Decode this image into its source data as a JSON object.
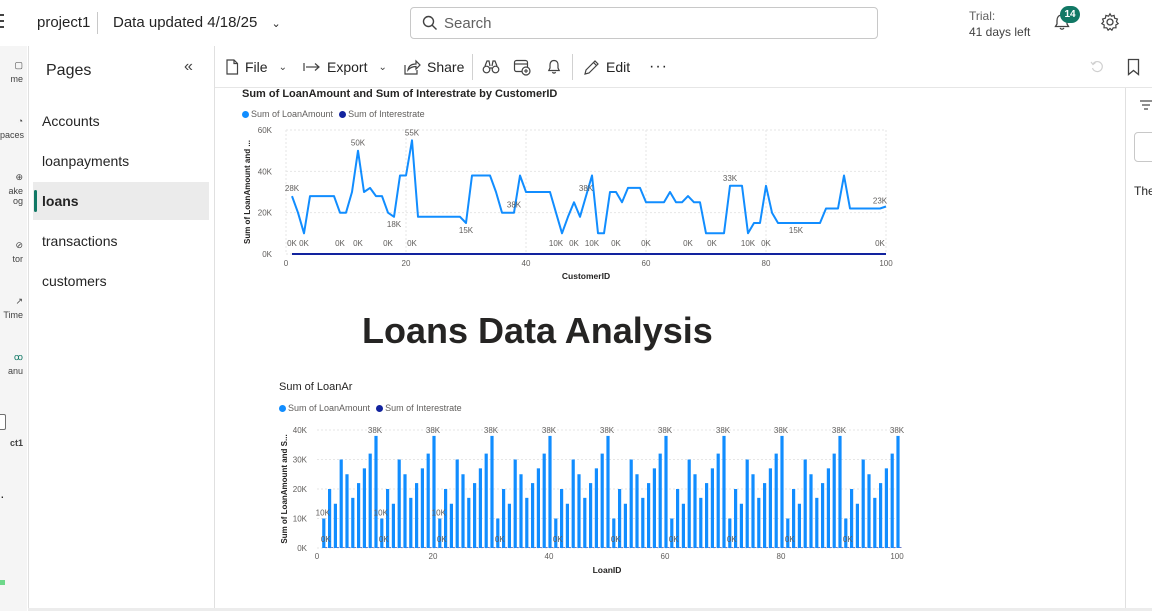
{
  "topbar": {
    "project_name": "project1",
    "data_updated": "Data updated 4/18/25",
    "search_placeholder": "Search",
    "trial_label": "Trial:",
    "trial_days": "41 days left",
    "notification_count": "14"
  },
  "left_rail": {
    "items": [
      "me",
      "paces",
      "ake",
      "og",
      "tor",
      "Time",
      "anu",
      "ct1"
    ]
  },
  "pages": {
    "title": "Pages",
    "items": [
      {
        "label": "Accounts"
      },
      {
        "label": "loanpayments"
      },
      {
        "label": "loans",
        "active": true
      },
      {
        "label": "transactions"
      },
      {
        "label": "customers"
      }
    ]
  },
  "toolbar": {
    "file": "File",
    "export": "Export",
    "share": "Share",
    "edit": "Edit"
  },
  "right_panel": {
    "text": "The"
  },
  "report": {
    "heading": "Loans Data Analysis"
  },
  "colors": {
    "series_loan": "#118DFF",
    "series_interest": "#12239E",
    "accent": "#117865"
  },
  "chart_data": [
    {
      "type": "line",
      "title": "Sum of LoanAmount and Sum of Interestrate by CustomerID",
      "xlabel": "CustomerID",
      "ylabel": "Sum of LoanAmount and ...",
      "xlim": [
        0,
        100
      ],
      "ylim": [
        0,
        60000
      ],
      "x_ticks": [
        "0",
        "20",
        "40",
        "60",
        "80",
        "100"
      ],
      "y_ticks": [
        "0K",
        "20K",
        "40K",
        "60K"
      ],
      "legend": [
        "Sum of LoanAmount",
        "Sum of Interestrate"
      ],
      "series": [
        {
          "name": "Sum of LoanAmount",
          "x": [
            1,
            2,
            3,
            4,
            5,
            6,
            7,
            8,
            9,
            10,
            11,
            12,
            13,
            14,
            15,
            16,
            17,
            18,
            19,
            20,
            21,
            22,
            23,
            24,
            25,
            26,
            27,
            28,
            29,
            30,
            31,
            32,
            33,
            34,
            35,
            36,
            37,
            38,
            39,
            40,
            41,
            42,
            43,
            44,
            45,
            46,
            47,
            48,
            49,
            50,
            51,
            52,
            53,
            54,
            55,
            56,
            57,
            58,
            59,
            60,
            61,
            62,
            63,
            64,
            65,
            66,
            67,
            68,
            69,
            70,
            71,
            72,
            73,
            74,
            75,
            76,
            77,
            78,
            79,
            80,
            81,
            82,
            83,
            84,
            85,
            86,
            87,
            88,
            89,
            90,
            91,
            92,
            93,
            94,
            95,
            96,
            97,
            98,
            99,
            100
          ],
          "values": [
            28000,
            20000,
            10000,
            28000,
            28000,
            28000,
            28000,
            28000,
            20000,
            20000,
            30000,
            50000,
            30000,
            32000,
            28000,
            28000,
            20000,
            18000,
            38000,
            38000,
            55000,
            18000,
            18000,
            18000,
            18000,
            18000,
            18000,
            18000,
            18000,
            15000,
            38000,
            38000,
            38000,
            38000,
            30000,
            20000,
            20000,
            20000,
            38000,
            30000,
            30000,
            30000,
            30000,
            30000,
            20000,
            10000,
            18000,
            25000,
            18000,
            28000,
            38000,
            10000,
            10000,
            30000,
            30000,
            25000,
            32000,
            32000,
            32000,
            25000,
            25000,
            25000,
            25000,
            30000,
            25000,
            25000,
            28000,
            25000,
            25000,
            10000,
            10000,
            10000,
            10000,
            33000,
            33000,
            33000,
            10000,
            15000,
            15000,
            33000,
            20000,
            15000,
            15000,
            15000,
            15000,
            15000,
            15000,
            15000,
            15000,
            22000,
            22000,
            22000,
            38000,
            22000,
            22000,
            22000,
            22000,
            22000,
            22000,
            23000
          ]
        },
        {
          "name": "Sum of Interestrate",
          "x": [
            1,
            100
          ],
          "values": [
            0,
            0
          ]
        }
      ],
      "data_labels": [
        {
          "x": 1,
          "text": "28K"
        },
        {
          "x": 12,
          "text": "50K"
        },
        {
          "x": 21,
          "text": "55K"
        },
        {
          "x": 18,
          "text": "18K"
        },
        {
          "x": 30,
          "text": "15K"
        },
        {
          "x": 38,
          "text": "38K"
        },
        {
          "x": 50,
          "text": "38K"
        },
        {
          "x": 74,
          "text": "33K"
        },
        {
          "x": 85,
          "text": "15K"
        },
        {
          "x": 99,
          "text": "23K"
        },
        {
          "x": 1,
          "text": "0K",
          "zero": true
        },
        {
          "x": 3,
          "text": "0K",
          "zero": true
        },
        {
          "x": 9,
          "text": "0K",
          "zero": true
        },
        {
          "x": 12,
          "text": "0K",
          "zero": true
        },
        {
          "x": 17,
          "text": "0K",
          "zero": true
        },
        {
          "x": 21,
          "text": "0K",
          "zero": true
        },
        {
          "x": 45,
          "text": "10K",
          "zero": true
        },
        {
          "x": 48,
          "text": "0K",
          "zero": true
        },
        {
          "x": 51,
          "text": "10K",
          "zero": true
        },
        {
          "x": 55,
          "text": "0K",
          "zero": true
        },
        {
          "x": 60,
          "text": "0K",
          "zero": true
        },
        {
          "x": 67,
          "text": "0K",
          "zero": true
        },
        {
          "x": 71,
          "text": "0K",
          "zero": true
        },
        {
          "x": 77,
          "text": "10K",
          "zero": true
        },
        {
          "x": 80,
          "text": "0K",
          "zero": true
        },
        {
          "x": 99,
          "text": "0K",
          "zero": true
        }
      ]
    },
    {
      "type": "bar",
      "title": "Sum of LoanAr",
      "xlabel": "LoanID",
      "ylabel": "Sum of LoanAmount and S...",
      "xlim": [
        0,
        100
      ],
      "ylim": [
        0,
        40000
      ],
      "x_ticks": [
        "0",
        "20",
        "40",
        "60",
        "80",
        "100"
      ],
      "y_ticks": [
        "0K",
        "10K",
        "20K",
        "30K",
        "40K"
      ],
      "legend": [
        "Sum of LoanAmount",
        "Sum of Interestrate"
      ],
      "pattern": [
        10000,
        20000,
        15000,
        30000,
        25000,
        17000,
        22000,
        27000,
        32000,
        38000
      ],
      "peak_labels": [
        "38K",
        "38K",
        "38K",
        "38K",
        "38K",
        "38K",
        "38K",
        "38K",
        "38K",
        "38K"
      ],
      "small_labels": [
        "10K",
        "10K",
        "10K"
      ],
      "zero_label": "0K"
    }
  ]
}
